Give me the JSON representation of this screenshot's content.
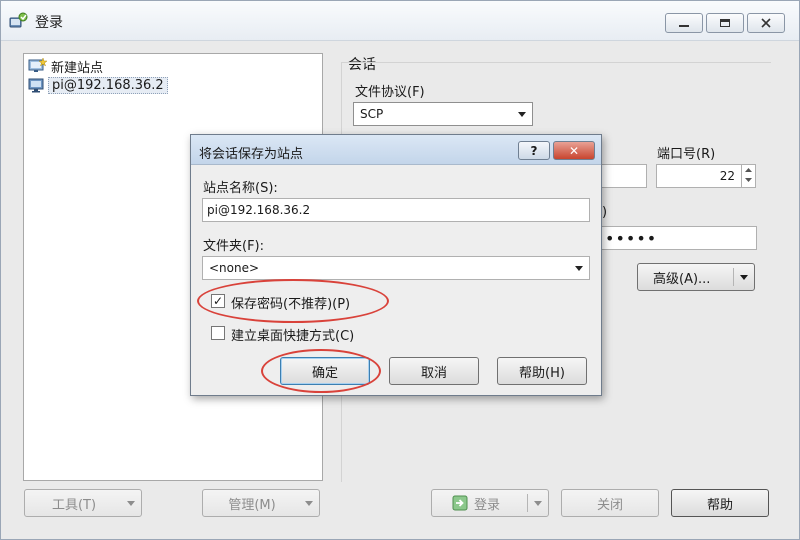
{
  "window": {
    "title": "登录"
  },
  "site_tree": {
    "items": [
      {
        "label": "新建站点"
      },
      {
        "label": "pi@192.168.36.2"
      }
    ]
  },
  "session": {
    "group_label": "会话",
    "protocol_label": "文件协议(F)",
    "protocol_value": "SCP",
    "port_label": "端口号(R)",
    "port_value": "22",
    "password_fragment": ")",
    "password_mask": "•••••",
    "advanced_label": "高级(A)..."
  },
  "bottom_bar": {
    "tools_label": "工具(T)",
    "manage_label": "管理(M)",
    "login_label": "登录",
    "close_label": "关闭",
    "help_label": "帮助"
  },
  "dialog": {
    "title": "将会话保存为站点",
    "help_symbol": "?",
    "close_symbol": "✕",
    "site_name_label": "站点名称(S):",
    "site_name_value": "pi@192.168.36.2",
    "folder_label": "文件夹(F):",
    "folder_value": "<none>",
    "save_password_label": "保存密码(不推荐)(P)",
    "save_password_checked": true,
    "check_mark": "✓",
    "desktop_shortcut_label": "建立桌面快捷方式(C)",
    "desktop_shortcut_checked": false,
    "ok_label": "确定",
    "cancel_label": "取消",
    "help_label": "帮助(H)"
  },
  "colors": {
    "highlight": "#d9423a",
    "login_icon": "#3aa23a"
  }
}
